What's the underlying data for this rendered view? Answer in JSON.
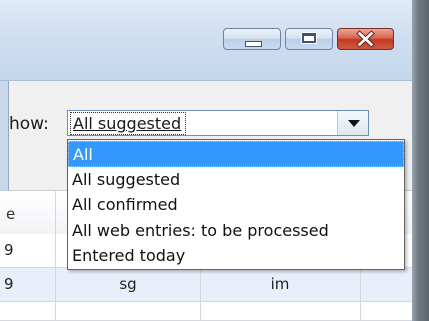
{
  "window": {
    "minimize_icon": "minimize-icon",
    "maximize_icon": "maximize-icon",
    "close_icon": "close-icon"
  },
  "filter": {
    "label": "how:",
    "selected_value": "All suggested",
    "options": [
      {
        "label": "All",
        "highlighted": true
      },
      {
        "label": "All suggested",
        "highlighted": false
      },
      {
        "label": "All confirmed",
        "highlighted": false
      },
      {
        "label": "All web entries: to be processed",
        "highlighted": false
      },
      {
        "label": "Entered today",
        "highlighted": false
      }
    ]
  },
  "grid": {
    "header_partial": "e",
    "rows": [
      {
        "c0": "9",
        "c1": "",
        "c2": ""
      },
      {
        "c0": "9",
        "c1": "sg",
        "c2": "im"
      }
    ]
  },
  "colors": {
    "highlight": "#3399ff",
    "close_button": "#c23a24",
    "alt_row": "#e8eefa"
  }
}
